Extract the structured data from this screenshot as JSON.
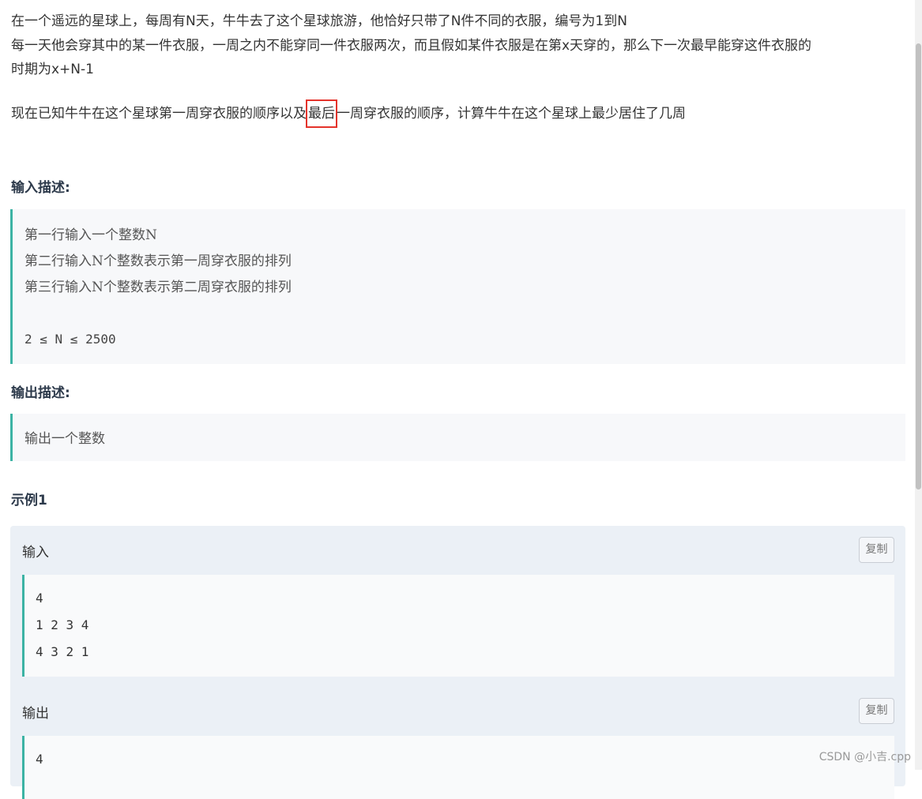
{
  "problem": {
    "line1": "在一个遥远的星球上，每周有N天，牛牛去了这个星球旅游，他恰好只带了N件不同的衣服，编号为1到N",
    "line2": "每一天他会穿其中的某一件衣服，一周之内不能穿同一件衣服两次，而且假如某件衣服是在第x天穿的，那么下一次最早能穿这件衣服的",
    "line3": "时期为x+N-1",
    "line4_before": "现在已知牛牛在这个星球第一周穿衣服的顺序以及",
    "line4_highlight": "最后",
    "line4_after": "一周穿衣服的顺序，计算牛牛在这个星球上最少居住了几周"
  },
  "input_section": {
    "heading": "输入描述:",
    "lines": [
      "第一行输入一个整数N",
      "第二行输入N个整数表示第一周穿衣服的排列",
      "第三行输入N个整数表示第二周穿衣服的排列"
    ],
    "constraint": "2 ≤ N ≤ 2500"
  },
  "output_section": {
    "heading": "输出描述:",
    "line": "输出一个整数"
  },
  "example": {
    "heading": "示例1",
    "input_label": "输入",
    "output_label": "输出",
    "copy_label": "复制",
    "input_lines": [
      "4",
      "1 2 3 4",
      "4 3 2 1"
    ],
    "output_lines": [
      "4"
    ]
  },
  "watermark": "CSDN @小吉.cpp"
}
